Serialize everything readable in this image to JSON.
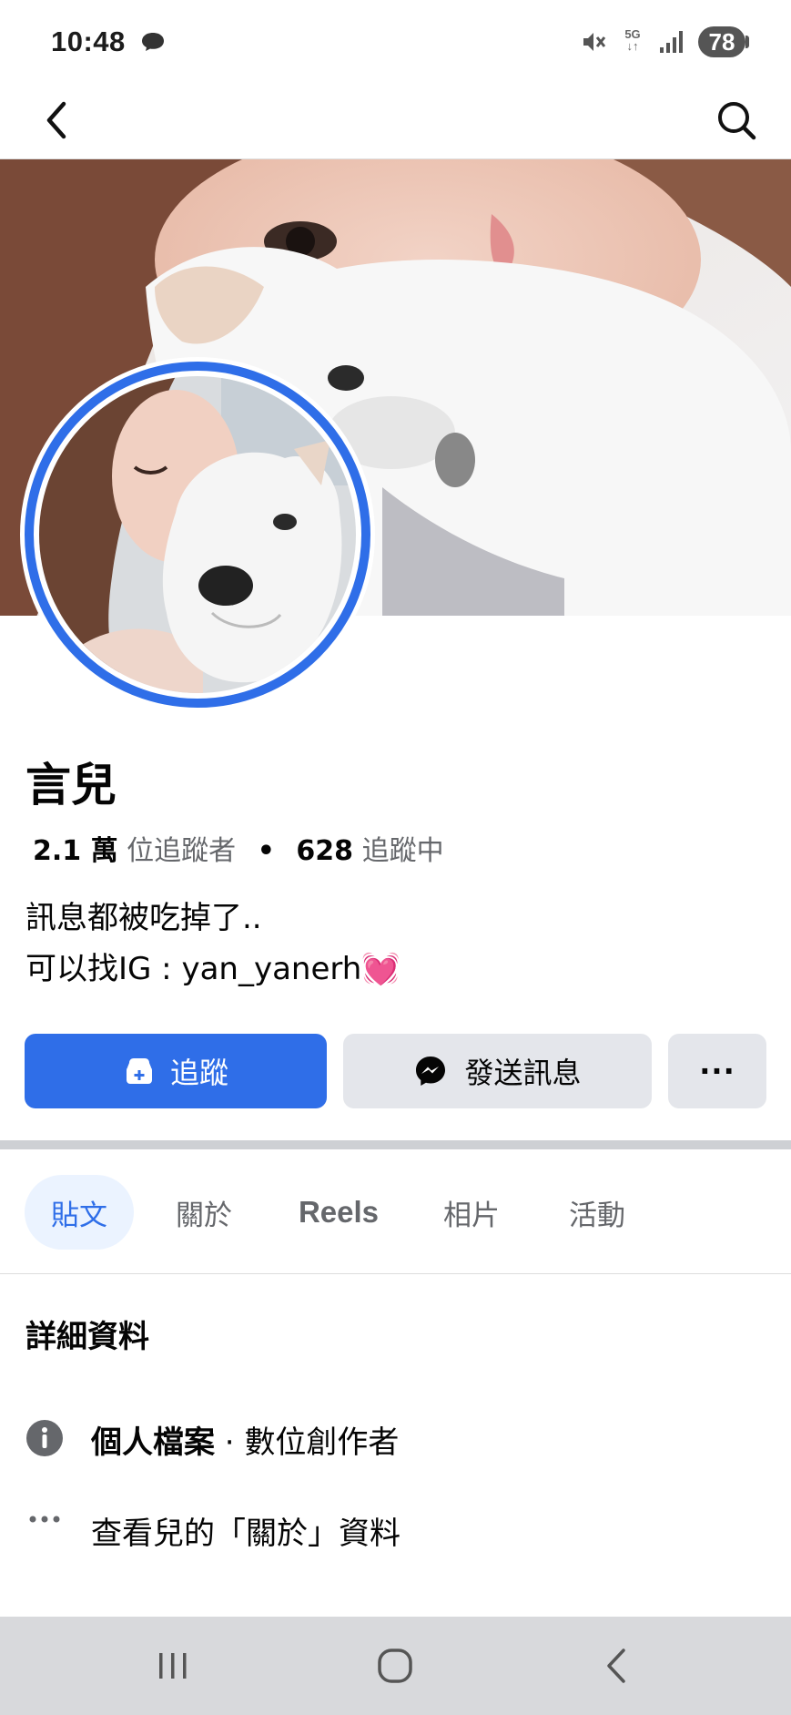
{
  "status_bar": {
    "time": "10:48",
    "network": "5G",
    "battery": "78",
    "icons": [
      "chat-bubble-icon",
      "mute-icon",
      "5g-icon",
      "signal-icon",
      "battery-icon"
    ]
  },
  "nav": {
    "back_icon": "chevron-left-icon",
    "search_icon": "search-icon"
  },
  "profile": {
    "name": "言兒",
    "followers_count": "2.1 萬",
    "followers_label": "位追蹤者",
    "following_count": "628",
    "following_label": "追蹤中",
    "bio_line_1": "訊息都被吃掉了..",
    "bio_line_2": "可以找IG : yan_yanerh",
    "bio_emoji": "💓"
  },
  "actions": {
    "follow_label": "追蹤",
    "message_label": "發送訊息",
    "more_label": "···"
  },
  "tabs": [
    {
      "label": "貼文",
      "active": true
    },
    {
      "label": "關於",
      "active": false
    },
    {
      "label": "Reels",
      "active": false
    },
    {
      "label": "相片",
      "active": false
    },
    {
      "label": "活動",
      "active": false
    }
  ],
  "details": {
    "heading": "詳細資料",
    "profile_type_label": "個人檔案",
    "profile_type_sep": " · ",
    "profile_type_value": "數位創作者",
    "about_link": "查看兒的「關於」資料"
  },
  "colors": {
    "accent": "#2f6ee8",
    "button_gray": "#e4e6eb",
    "text": "#050505",
    "secondary_text": "#65676b",
    "tab_active_bg": "#ebf3ff"
  }
}
